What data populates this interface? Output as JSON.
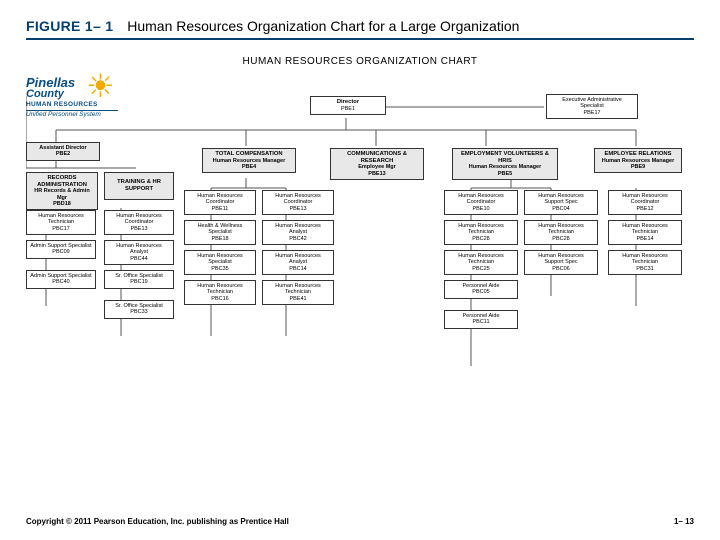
{
  "figure_number": "FIGURE 1– 1",
  "figure_title": "Human Resources Organization Chart for a Large Organization",
  "chart_heading": "HUMAN RESOURCES ORGANIZATION CHART",
  "logo": {
    "line1": "Pinellas",
    "line2": "County",
    "hr": "HUMAN RESOURCES",
    "tag": "Unified Personnel System"
  },
  "top": {
    "director": {
      "t": "Director",
      "s": "PBE1"
    },
    "exec": {
      "t": "Executive Administrative Specialist",
      "s": "PBE17"
    }
  },
  "asst": {
    "t": "Assistant Director",
    "s": "PBE2"
  },
  "divisions": {
    "records": {
      "h": "RECORDS ADMINISTRATION",
      "s1": "HR Records & Admin Mgr",
      "s2": "PBD18"
    },
    "training": {
      "h": "TRAINING & HR SUPPORT"
    },
    "totalcomp": {
      "h": "TOTAL COMPENSATION",
      "s1": "Human Resources Manager",
      "s2": "PBE4"
    },
    "comm": {
      "h": "COMMUNICATIONS & RESEARCH",
      "s1": "Employee Mgr",
      "s2": "PBE13"
    },
    "emp": {
      "h": "EMPLOYMENT VOLUNTEERS & HRIS",
      "s1": "Human Resources Manager",
      "s2": "PBE5"
    },
    "rel": {
      "h": "EMPLOYEE RELATIONS",
      "s1": "Human Resources Manager",
      "s2": "PBE9"
    }
  },
  "col_records": [
    {
      "t": "Human Resources Technician",
      "s": "PBC17"
    },
    {
      "t": "Admin Support Specialist",
      "s": "PBC09"
    },
    {
      "t": "Admin Support Specialist",
      "s": "PBC40"
    }
  ],
  "col_training": [
    {
      "t": "Human Resources Coordinator",
      "s": "PBE13"
    },
    {
      "t": "Human Resources Analyst",
      "s": "PBC44"
    },
    {
      "t": "Sr. Office Specialist",
      "s": "PBC19"
    },
    {
      "t": "Sr. Office Specialist",
      "s": "PBC33"
    }
  ],
  "col_tc_a": [
    {
      "t": "Human Resources Coordinator",
      "s": "PBE11"
    },
    {
      "t": "Health & Wellness Specialist",
      "s": "PBE18"
    },
    {
      "t": "Human Resources Specialist",
      "s": "PBC35"
    },
    {
      "t": "Human Resources Technician",
      "s": "PBC16"
    }
  ],
  "col_tc_b": [
    {
      "t": "Human Resources Coordinator",
      "s": "PBE13"
    },
    {
      "t": "Human Resources Analyst",
      "s": "PBC42"
    },
    {
      "t": "Human Resources Analyst",
      "s": "PBC14"
    },
    {
      "t": "Human Resources Technician",
      "s": "PBE41"
    }
  ],
  "col_comm": [],
  "col_emp": [
    {
      "t": "Human Resources Coordinator",
      "s": "PBE10"
    },
    {
      "t": "Human Resources Technician",
      "s": "PBC28"
    },
    {
      "t": "Human Resources Technician",
      "s": "PBC25"
    },
    {
      "t": "Personnel Aide",
      "s": "PBC05"
    },
    {
      "t": "Personnel Aide",
      "s": "PBC11"
    }
  ],
  "col_emp_b": [
    {
      "t": "Human Resources Support Spec",
      "s": "PBC04"
    },
    {
      "t": "Human Resources Technician",
      "s": "PBC28"
    },
    {
      "t": "Human Resources Support Spec",
      "s": "PBC06"
    }
  ],
  "col_rel": [
    {
      "t": "Human Resources Coordinator",
      "s": "PBE12"
    },
    {
      "t": "Human Resources Technician",
      "s": "PBE14"
    },
    {
      "t": "Human Resources Technician",
      "s": "PBC31"
    }
  ],
  "footer": {
    "copy": "Copyright © 2011 Pearson Education, Inc. publishing as Prentice Hall",
    "page": "1– 13"
  }
}
